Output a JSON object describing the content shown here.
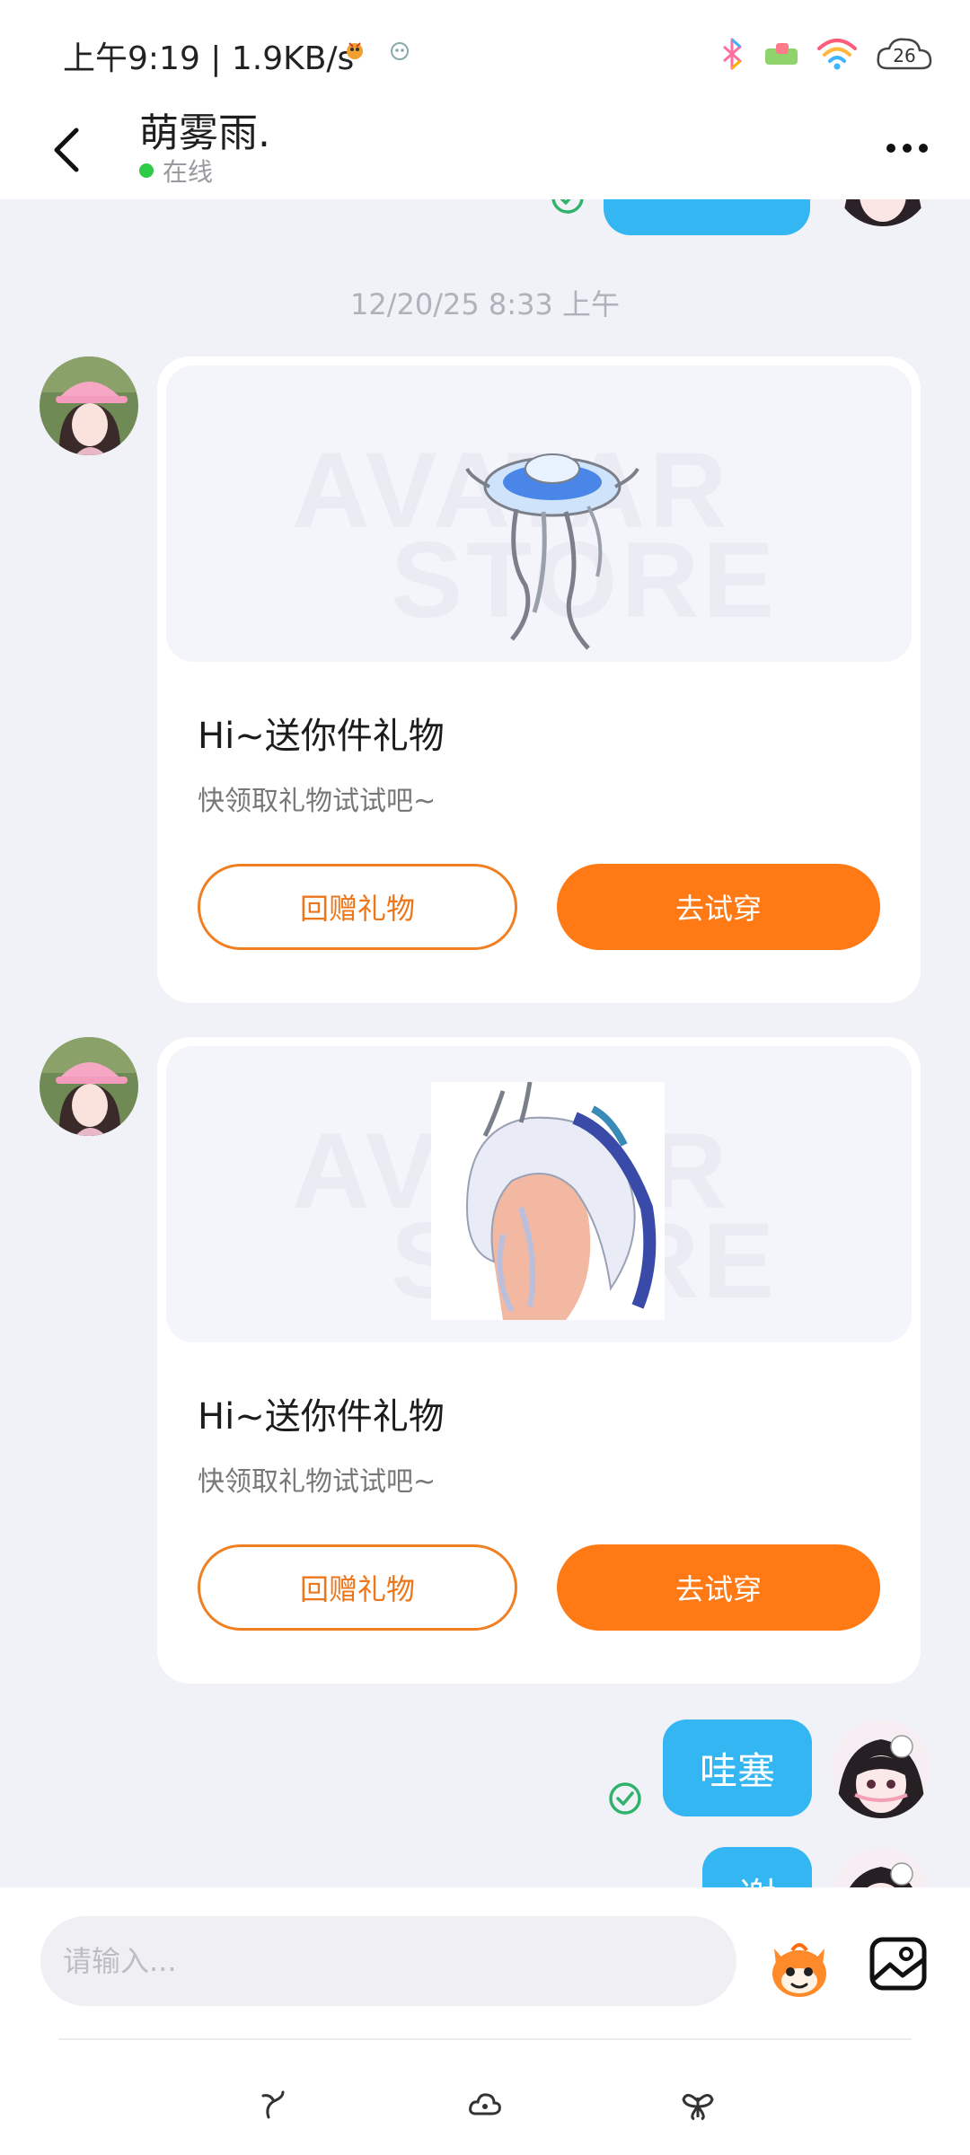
{
  "status_bar": {
    "time_speed": "上午9:19 | 1.9KB/s",
    "battery": "26"
  },
  "header": {
    "title": "萌雾雨.",
    "status": "在线"
  },
  "chat": {
    "timestamp": "12/20/25 8:33 上午",
    "gift_cards": [
      {
        "watermark_line1": "AVATAR",
        "watermark_line2": "STORE",
        "title": "Hi~送你件礼物",
        "subtitle": "快领取礼物试试吧~",
        "return_label": "回赠礼物",
        "try_label": "去试穿"
      },
      {
        "watermark_line1": "AVATAR",
        "watermark_line2": "STORE",
        "title": "Hi~送你件礼物",
        "subtitle": "快领取礼物试试吧~",
        "return_label": "回赠礼物",
        "try_label": "去试穿"
      }
    ],
    "outgoing": [
      {
        "text": "哇塞"
      },
      {
        "text": "谢"
      }
    ]
  },
  "composer": {
    "placeholder": "请输入..."
  },
  "colors": {
    "accent_orange": "#ff7a14",
    "bubble_blue": "#34b6f2",
    "online_green": "#2ecb46",
    "sent_check": "#2fb26b"
  },
  "icons": [
    "back-arrow-icon",
    "more-icon",
    "sent-check-icon",
    "emoji-mascot-icon",
    "image-icon",
    "sprout-icon",
    "cloud-icon",
    "butterfly-icon"
  ]
}
